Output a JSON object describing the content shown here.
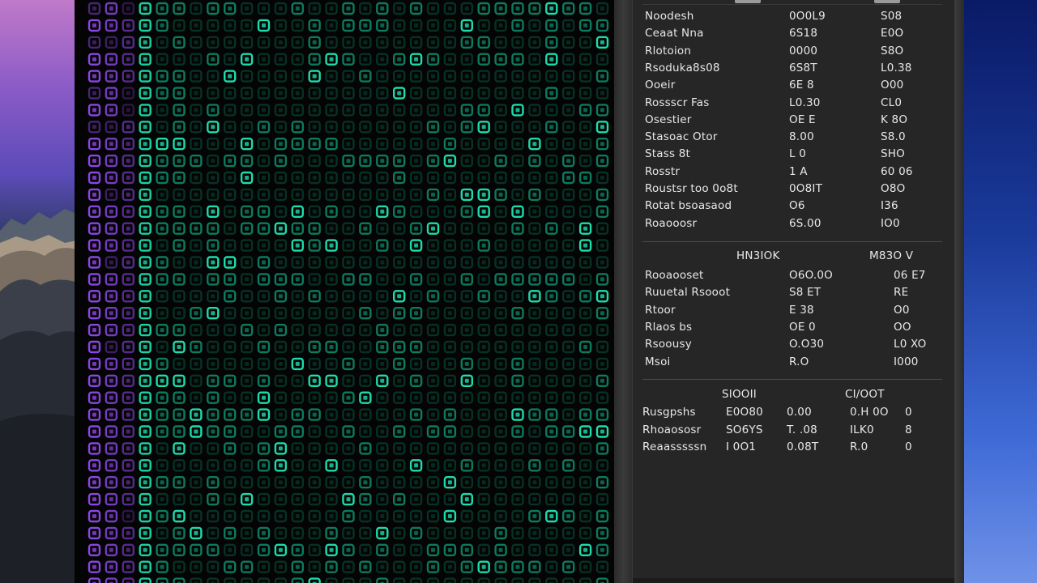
{
  "colors": {
    "grid_background": "#040404",
    "cell_green_bright": "#1de9b6",
    "cell_green_mid": "#0fa37c",
    "cell_green_dim": "#0a5a44",
    "cell_purple": "#9b4dff",
    "panel_background": "#262626",
    "panel_text": "#e8e8e8"
  },
  "stats": {
    "section1": {
      "rows": [
        {
          "label": "Noodesh",
          "v1": "0O0L9",
          "v2": "S08"
        },
        {
          "label": "Ceaat Nna",
          "v1": "6S18",
          "v2": "E0O"
        },
        {
          "label": "Rlotoion",
          "v1": "0000",
          "v2": "S8O"
        },
        {
          "label": "Rsoduka8s08",
          "v1": "6S8T",
          "v2": "L0.38"
        },
        {
          "label": "Ooeir",
          "v1": "6E 8",
          "v2": "O00"
        },
        {
          "label": "Rossscr Fas",
          "v1": "L0.30",
          "v2": "CL0"
        },
        {
          "label": "Osestier",
          "v1": "OE E",
          "v2": "K 8O"
        },
        {
          "label": "Stasoac Otor",
          "v1": "8.00",
          "v2": "S8.0"
        },
        {
          "label": "Stass 8t",
          "v1": "L 0",
          "v2": "SHO"
        },
        {
          "label": "Rosstr",
          "v1": "1 A",
          "v2": "60 06"
        },
        {
          "label": "Roustsr too 0o8t",
          "v1": "0O8IT",
          "v2": "O8O"
        },
        {
          "label": "Rotat bsoasaod",
          "v1": "O6",
          "v2": "I36"
        },
        {
          "label": "Roaooosr",
          "v1": "6S.00",
          "v2": "IO0"
        }
      ]
    },
    "section2": {
      "header1": "HN3IOK",
      "header2": "M83O V",
      "rows": [
        {
          "label": "Rooaooset",
          "v1": "O6O.0O",
          "v2": "06 E7"
        },
        {
          "label": "Ruuetal Rsooot",
          "v1": "S8 ET",
          "v2": "RE"
        },
        {
          "label": "Rtoor",
          "v1": "E 38",
          "v2": "O0"
        },
        {
          "label": "Rlaos bs",
          "v1": "OE 0",
          "v2": "OO"
        },
        {
          "label": "Rsoousy",
          "v1": "O.O30",
          "v2": "L0 XO"
        },
        {
          "label": "Msoi",
          "v1": "R.O",
          "v2": "I000"
        }
      ]
    },
    "section3": {
      "header1": "SIOOII",
      "header2": "CI/OOT",
      "rows": [
        {
          "label": "Rusgpshs",
          "v1": "E0O80",
          "v2": "0.00",
          "v3": "0.H 0O",
          "v4": "0"
        },
        {
          "label": "Rhoaososr",
          "v1": "SO6YS",
          "v2": "T. .08",
          "v3": "ILK0",
          "v4": "8"
        },
        {
          "label": "Reaasssssn",
          "v1": "I 0O1",
          "v2": "0.08T",
          "v3": "R.0",
          "v4": "0"
        }
      ]
    }
  }
}
